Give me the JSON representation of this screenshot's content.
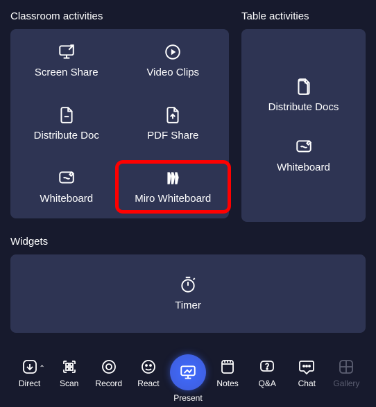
{
  "sections": {
    "classroom_title": "Classroom activities",
    "table_title": "Table activities",
    "widgets_title": "Widgets"
  },
  "classroom": {
    "screen_share": "Screen Share",
    "video_clips": "Video Clips",
    "distribute_doc": "Distribute Doc",
    "pdf_share": "PDF Share",
    "whiteboard": "Whiteboard",
    "miro_whiteboard": "Miro Whiteboard"
  },
  "table": {
    "distribute_docs": "Distribute Docs",
    "whiteboard": "Whiteboard"
  },
  "widgets": {
    "timer": "Timer"
  },
  "bottombar": {
    "direct": "Direct",
    "scan": "Scan",
    "record": "Record",
    "react": "React",
    "present": "Present",
    "notes": "Notes",
    "qa": "Q&A",
    "chat": "Chat",
    "gallery": "Gallery"
  }
}
